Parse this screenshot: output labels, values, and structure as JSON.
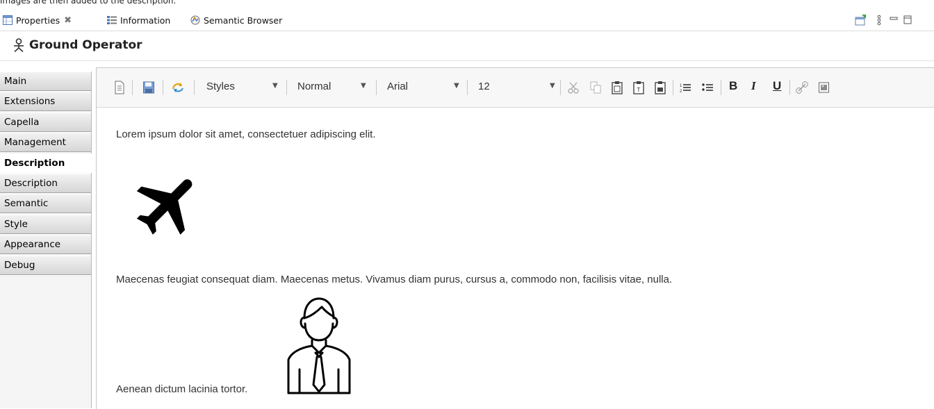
{
  "caption": "Images are then added to the description.",
  "tabs": [
    {
      "label": "Properties",
      "close": "✖"
    },
    {
      "label": "Information"
    },
    {
      "label": "Semantic Browser"
    }
  ],
  "header": {
    "title": "Ground Operator"
  },
  "sidebar": {
    "items": [
      {
        "label": "Main"
      },
      {
        "label": "Extensions"
      },
      {
        "label": "Capella"
      },
      {
        "label": "Management"
      },
      {
        "label": "Description"
      },
      {
        "label": "Description"
      },
      {
        "label": "Semantic"
      },
      {
        "label": "Style"
      },
      {
        "label": "Appearance"
      },
      {
        "label": "Debug"
      }
    ]
  },
  "toolbar": {
    "styles": "Styles",
    "format": "Normal",
    "font": "Arial",
    "size": "12",
    "bold": "B",
    "italic": "I",
    "underline": "U"
  },
  "editor": {
    "paragraphs": [
      "Lorem ipsum dolor sit amet, consectetuer adipiscing elit.",
      "Maecenas feugiat consequat diam. Maecenas metus. Vivamus diam purus, cursus a, commodo non, facilisis vitae, nulla.",
      "Aenean dictum lacinia tortor."
    ]
  }
}
